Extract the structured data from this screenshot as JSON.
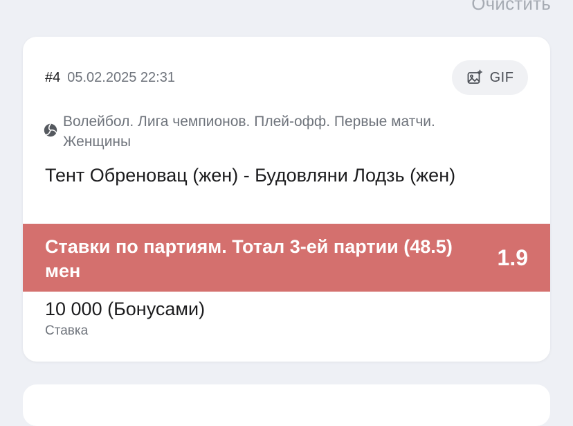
{
  "header": {
    "clear_label": "Очистить"
  },
  "bet": {
    "number": "#4",
    "datetime": "05.02.2025 22:31",
    "gif_label": "GIF",
    "sport_icon": "volleyball-icon",
    "tournament": "Волейбол. Лига чемпионов. Плей-офф. Первые матчи. Женщины",
    "event": "Тент Обреновац (жен) - Будовляни Лодзь (жен)",
    "outcome": "Ставки по партиям. Тотал 3-ей партии (48.5) мен",
    "coefficient": "1.9",
    "stake_amount": "10 000 (Бонусами)",
    "stake_label": "Ставка"
  },
  "colors": {
    "outcome_bar": "#d4706e",
    "background": "#eef0f5"
  }
}
